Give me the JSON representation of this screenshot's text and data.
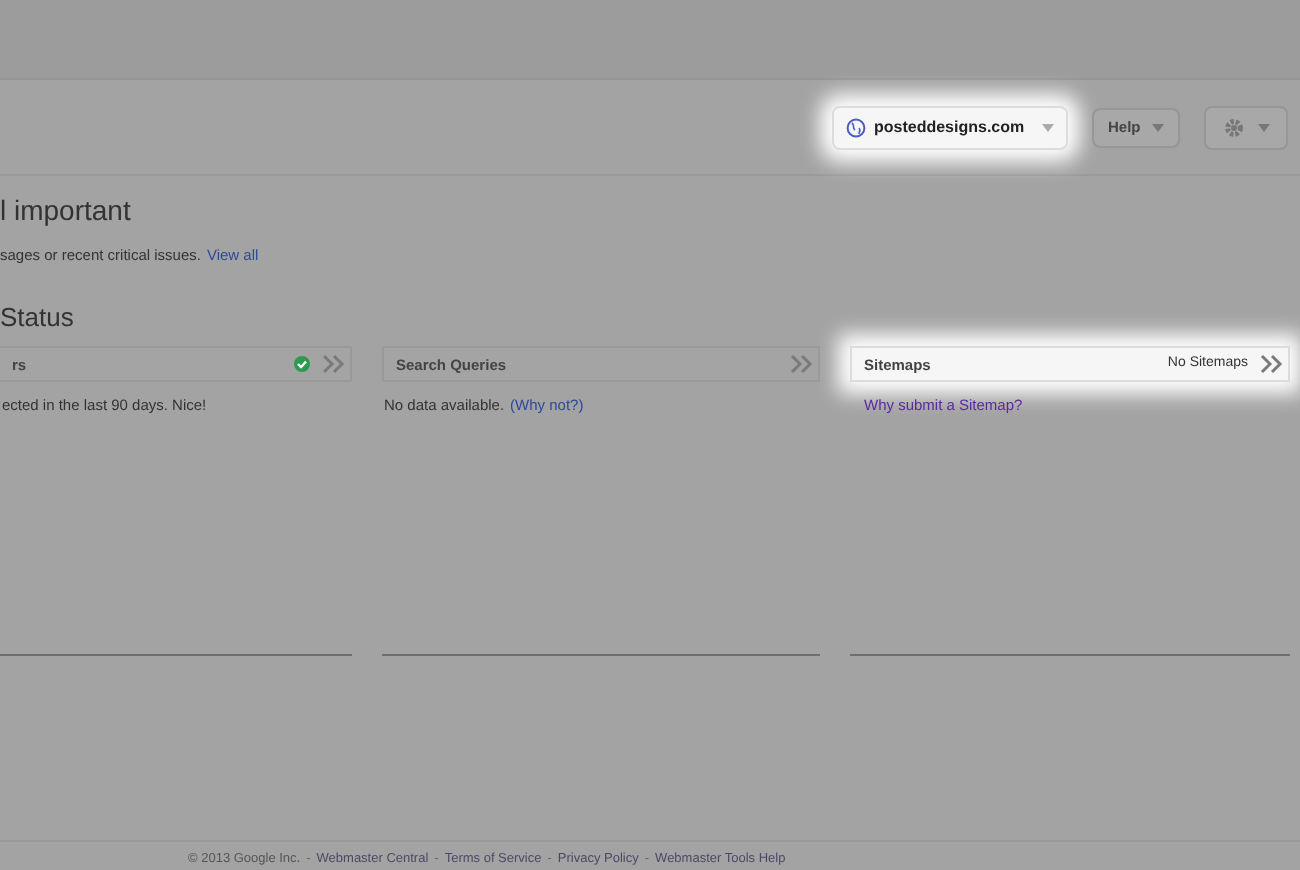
{
  "site_selector": {
    "label": "posteddesigns.com",
    "highlighted": true
  },
  "help_button": {
    "label": "Help"
  },
  "heading": "l important",
  "message": {
    "text": "sages or recent critical issues.",
    "link": "View all"
  },
  "section_title": "Status",
  "panels": [
    {
      "title": "rs",
      "ok": true,
      "highlighted": false,
      "text": "ected in the last 90 days. Nice!"
    },
    {
      "title": "Search Queries",
      "ok": false,
      "highlighted": false,
      "text": "No data available.",
      "link": "(Why not?)"
    },
    {
      "title": "Sitemaps",
      "ok": false,
      "note": "No Sitemaps",
      "highlighted": true,
      "link": "Why submit a Sitemap?"
    }
  ],
  "footer": [
    {
      "kind": "text",
      "text": "© 2013 Google Inc."
    },
    {
      "kind": "separator",
      "text": "-"
    },
    {
      "kind": "link",
      "text": "Webmaster Central"
    },
    {
      "kind": "separator",
      "text": "-"
    },
    {
      "kind": "link",
      "text": "Terms of Service"
    },
    {
      "kind": "separator",
      "text": "-"
    },
    {
      "kind": "link",
      "text": "Privacy Policy"
    },
    {
      "kind": "separator",
      "text": "-"
    },
    {
      "kind": "link",
      "text": "Webmaster Tools Help"
    }
  ]
}
